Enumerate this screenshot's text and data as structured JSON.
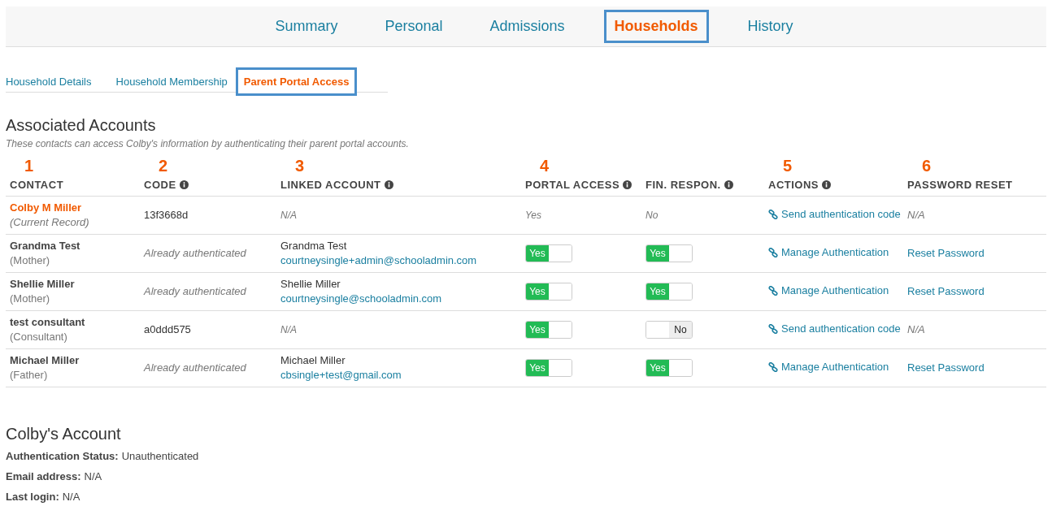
{
  "main_tabs": [
    {
      "label": "Summary",
      "selected": false
    },
    {
      "label": "Personal",
      "selected": false
    },
    {
      "label": "Admissions",
      "selected": false
    },
    {
      "label": "Households",
      "selected": true
    },
    {
      "label": "History",
      "selected": false
    }
  ],
  "sub_tabs": [
    {
      "label": "Household Details",
      "selected": false
    },
    {
      "label": "Household Membership",
      "selected": false
    },
    {
      "label": "Parent Portal Access",
      "selected": true
    }
  ],
  "associated_accounts": {
    "title": "Associated Accounts",
    "description": "These contacts can access Colby's information by authenticating their parent portal accounts.",
    "columns": [
      {
        "label": "CONTACT",
        "marker": "1",
        "info": false
      },
      {
        "label": "CODE",
        "marker": "2",
        "info": true
      },
      {
        "label": "LINKED ACCOUNT",
        "marker": "3",
        "info": true
      },
      {
        "label": "PORTAL ACCESS",
        "marker": "4",
        "info": true
      },
      {
        "label": "FIN. RESPON.",
        "info": true
      },
      {
        "label": "ACTIONS",
        "marker": "5",
        "info": true
      },
      {
        "label": "PASSWORD RESET",
        "marker": "6",
        "info": false
      }
    ],
    "rows": [
      {
        "contact": {
          "name": "Colby M Miller",
          "role": "(Current Record)",
          "current": true
        },
        "code": {
          "kind": "code",
          "text": "13f3668d"
        },
        "linked": {
          "kind": "none",
          "text": "N/A"
        },
        "portal": {
          "kind": "text",
          "text": "Yes"
        },
        "fin": {
          "kind": "text",
          "text": "No"
        },
        "action": "Send authentication code",
        "password": {
          "kind": "text",
          "text": "N/A"
        }
      },
      {
        "contact": {
          "name": "Grandma Test",
          "role": "(Mother)",
          "current": false
        },
        "code": {
          "kind": "note",
          "text": "Already authenticated"
        },
        "linked": {
          "kind": "account",
          "name": "Grandma Test",
          "email": "courtneysingle+admin@schooladmin.com"
        },
        "portal": {
          "kind": "toggle",
          "on": true,
          "text": "Yes"
        },
        "fin": {
          "kind": "toggle",
          "on": true,
          "text": "Yes"
        },
        "action": "Manage Authentication",
        "password": {
          "kind": "link",
          "text": "Reset Password"
        }
      },
      {
        "contact": {
          "name": "Shellie Miller",
          "role": "(Mother)",
          "current": false
        },
        "code": {
          "kind": "note",
          "text": "Already authenticated"
        },
        "linked": {
          "kind": "account",
          "name": "Shellie Miller",
          "email": "courtneysingle@schooladmin.com"
        },
        "portal": {
          "kind": "toggle",
          "on": true,
          "text": "Yes"
        },
        "fin": {
          "kind": "toggle",
          "on": true,
          "text": "Yes"
        },
        "action": "Manage Authentication",
        "password": {
          "kind": "link",
          "text": "Reset Password"
        }
      },
      {
        "contact": {
          "name": "test consultant",
          "role": "(Consultant)",
          "current": false
        },
        "code": {
          "kind": "code",
          "text": "a0ddd575"
        },
        "linked": {
          "kind": "none",
          "text": "N/A"
        },
        "portal": {
          "kind": "toggle",
          "on": true,
          "text": "Yes"
        },
        "fin": {
          "kind": "toggle",
          "on": false,
          "text": "No"
        },
        "action": "Send authentication code",
        "password": {
          "kind": "text",
          "text": "N/A"
        }
      },
      {
        "contact": {
          "name": "Michael Miller",
          "role": "(Father)",
          "current": false
        },
        "code": {
          "kind": "note",
          "text": "Already authenticated"
        },
        "linked": {
          "kind": "account",
          "name": "Michael Miller",
          "email": "cbsingle+test@gmail.com"
        },
        "portal": {
          "kind": "toggle",
          "on": true,
          "text": "Yes"
        },
        "fin": {
          "kind": "toggle",
          "on": true,
          "text": "Yes"
        },
        "action": "Manage Authentication",
        "password": {
          "kind": "link",
          "text": "Reset Password"
        }
      }
    ]
  },
  "student_account": {
    "title": "Colby's Account",
    "fields": [
      {
        "label": "Authentication Status:",
        "value": "Unauthenticated"
      },
      {
        "label": "Email address:",
        "value": "N/A"
      },
      {
        "label": "Last login:",
        "value": "N/A"
      }
    ]
  }
}
